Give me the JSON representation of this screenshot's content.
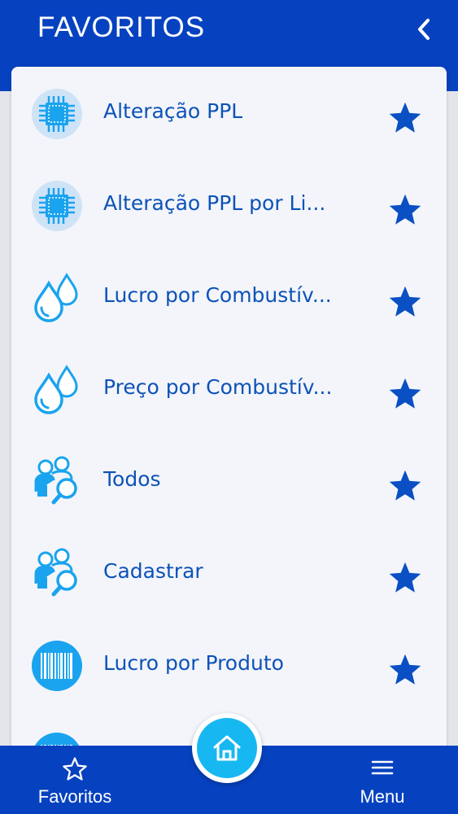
{
  "header": {
    "title": "FAVORITOS",
    "back_icon": "chevron-left-icon"
  },
  "favorites": [
    {
      "label": "Alteração PPL",
      "icon": "chip-icon"
    },
    {
      "label": "Alteração PPL por Li...",
      "icon": "chip-icon"
    },
    {
      "label": "Lucro por Combustív...",
      "icon": "drops-icon"
    },
    {
      "label": "Preço por Combustív...",
      "icon": "drops-icon"
    },
    {
      "label": "Todos",
      "icon": "people-search-icon"
    },
    {
      "label": "Cadastrar",
      "icon": "people-search-icon"
    },
    {
      "label": "Lucro por Produto",
      "icon": "barcode-icon"
    }
  ],
  "bottom_nav": {
    "favorites_label": "Favoritos",
    "menu_label": "Menu",
    "home_icon": "home-icon"
  },
  "colors": {
    "primary": "#0642c0",
    "card_bg": "#f3f5fa",
    "text_blue": "#0d52b8",
    "star": "#0a4fc4",
    "icon_blue": "#1aa3ee",
    "fab": "#17b8f1"
  }
}
